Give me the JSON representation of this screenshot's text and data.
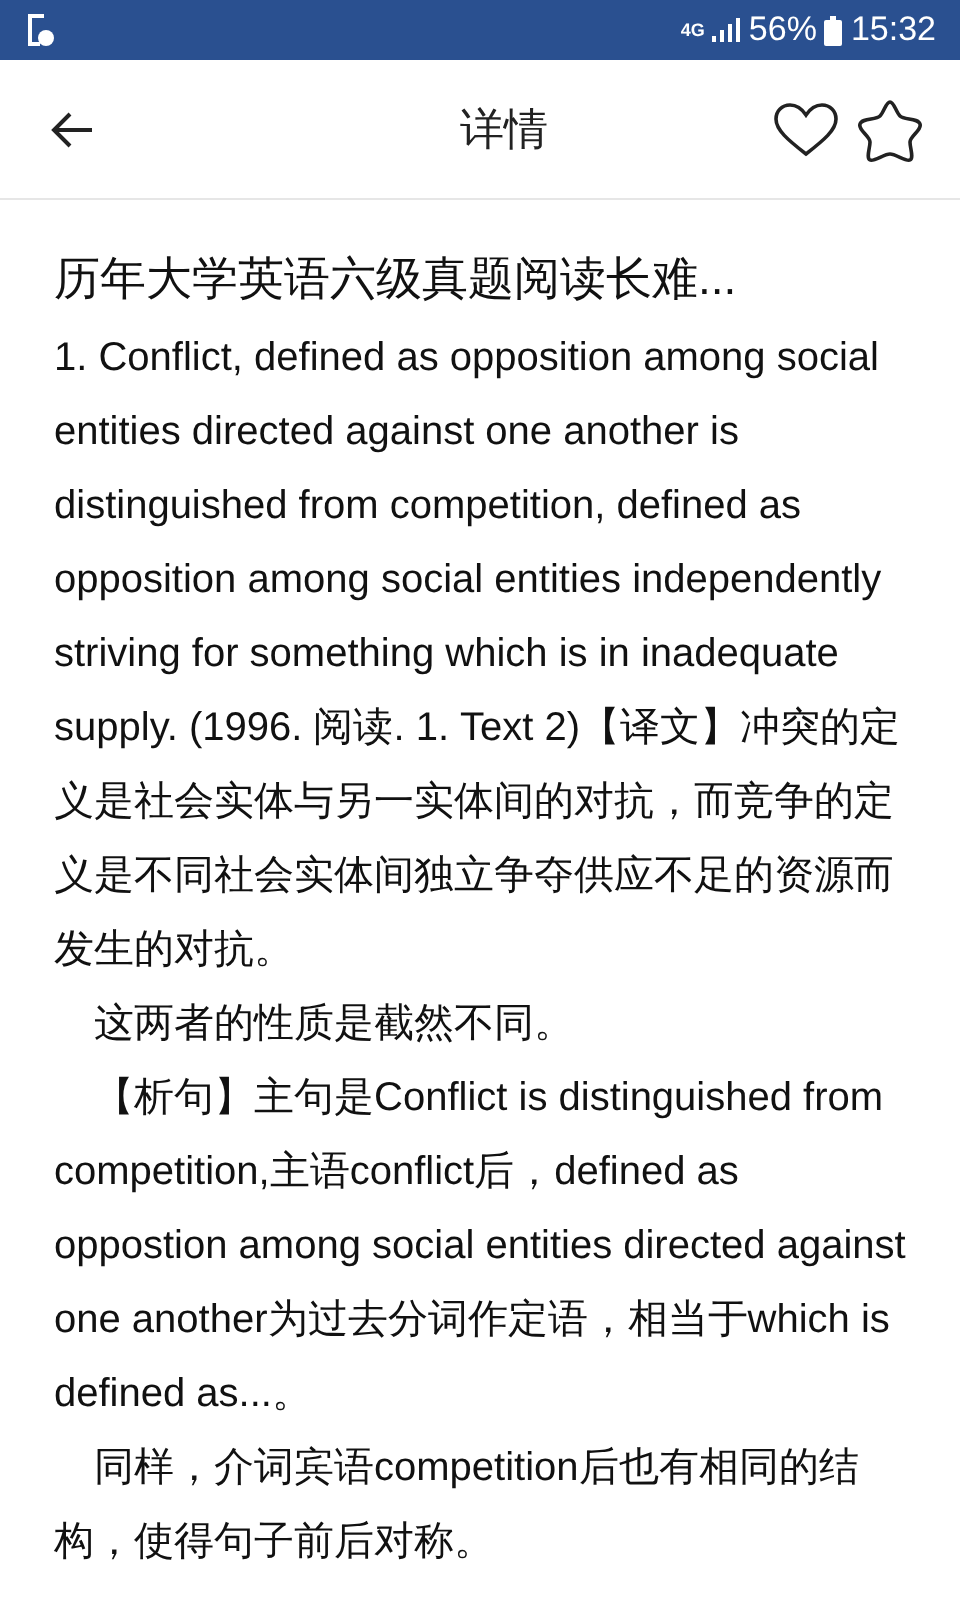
{
  "status_bar": {
    "network": "4G",
    "battery": "56%",
    "time": "15:32"
  },
  "header": {
    "title": "详情"
  },
  "article": {
    "title": "历年大学英语六级真题阅读长难...",
    "paragraphs": [
      {
        "text": "1. Conflict, defined as opposition among social entities directed against one another is distinguished from competition, defined as opposition among social entities independently striving for something which is in inadequate supply. (1996. 阅读. 1. Text 2)【译文】冲突的定义是社会实体与另一实体间的对抗，而竞争的定义是不同社会实体间独立争夺供应不足的资源而发生的对抗。",
        "indent": false
      },
      {
        "text": "这两者的性质是截然不同。",
        "indent": true
      },
      {
        "text": "【析句】主句是Conflict is distinguished from competition,主语conflict后，defined as oppostion among social entities directed against one another为过去分词作定语，相当于which is defined as...。",
        "indent": true
      },
      {
        "text": "同样，介词宾语competition后也有相同的结构，使得句子前后对称。",
        "indent": true
      }
    ]
  }
}
